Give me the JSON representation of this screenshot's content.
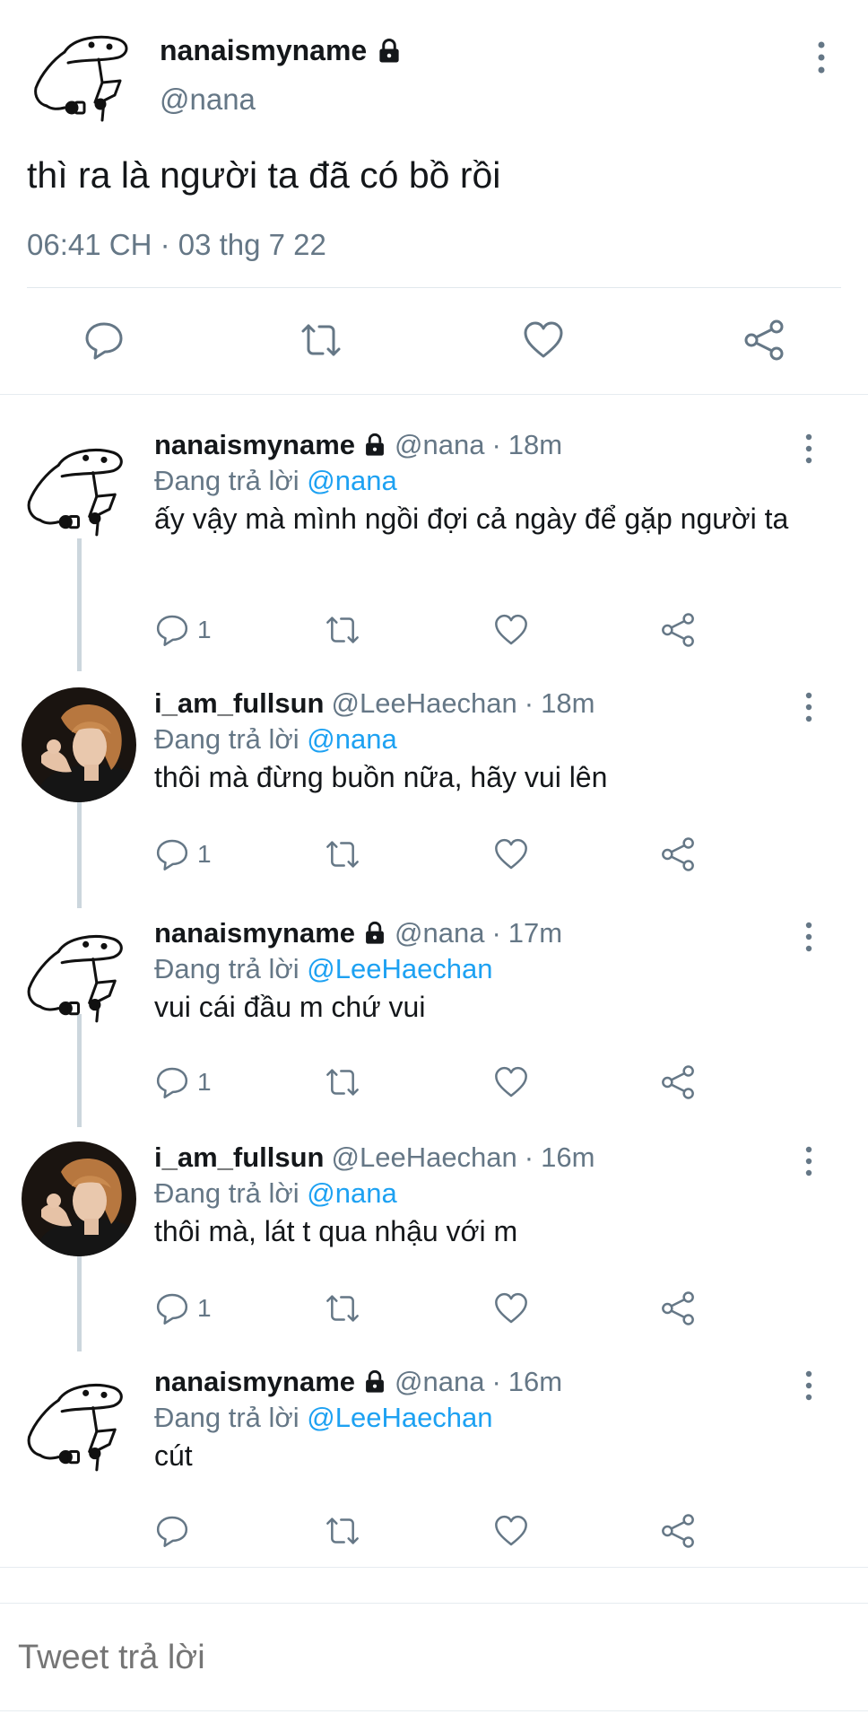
{
  "colors": {
    "text": "#14171a",
    "secondary": "#657786",
    "link": "#1da1f2",
    "divider": "#e6ecf0",
    "thread_line": "#ccd6dd"
  },
  "main_tweet": {
    "display_name": "nanaismyname",
    "handle": "@nana",
    "text": "thì ra là người ta đã có bồ rồi",
    "timestamp": "06:41 CH · 03 thg 7 22",
    "avatar": "doodle-sketch-avatar",
    "verified_lock": "lock-icon",
    "actions": [
      "reply-icon",
      "retweet-icon",
      "like-icon",
      "share-icon"
    ]
  },
  "replies": [
    {
      "display_name": "nanaismyname",
      "locked": true,
      "handle": "@nana",
      "dot": "·",
      "time": "18m",
      "replying_prefix": "Đang trả lời",
      "replying_to": "@nana",
      "text": "ấy vậy mà mình ngồi đợi cả ngày để gặp người ta",
      "reply_count": "1",
      "avatar": "doodle-sketch-avatar"
    },
    {
      "display_name": "i_am_fullsun",
      "locked": false,
      "handle": "@LeeHaechan",
      "dot": "·",
      "time": "18m",
      "replying_prefix": "Đang trả lời",
      "replying_to": "@nana",
      "text": "thôi mà đừng buồn nữa, hãy vui lên",
      "reply_count": "1",
      "avatar": "photo-avatar"
    },
    {
      "display_name": "nanaismyname",
      "locked": true,
      "handle": "@nana",
      "dot": "·",
      "time": "17m",
      "replying_prefix": "Đang trả lời",
      "replying_to": "@LeeHaechan",
      "text": "vui cái đầu m chứ vui",
      "reply_count": "1",
      "avatar": "doodle-sketch-avatar"
    },
    {
      "display_name": "i_am_fullsun",
      "locked": false,
      "handle": "@LeeHaechan",
      "dot": "·",
      "time": "16m",
      "replying_prefix": "Đang trả lời",
      "replying_to": "@nana",
      "text": "thôi mà, lát t qua nhậu với m",
      "reply_count": "1",
      "avatar": "photo-avatar"
    },
    {
      "display_name": "nanaismyname",
      "locked": true,
      "handle": "@nana",
      "dot": "·",
      "time": "16m",
      "replying_prefix": "Đang trả lời",
      "replying_to": "@LeeHaechan",
      "text": "cút",
      "reply_count": "",
      "avatar": "doodle-sketch-avatar"
    }
  ],
  "composer": {
    "placeholder": "Tweet trả lời"
  }
}
